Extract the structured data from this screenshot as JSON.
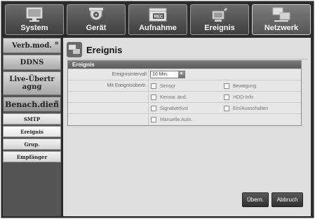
{
  "topnav": {
    "tabs": [
      {
        "label": "System",
        "icon": "monitor-icon",
        "active": false
      },
      {
        "label": "Gerät",
        "icon": "camera-icon",
        "active": false
      },
      {
        "label": "Aufnahme",
        "icon": "rec-icon",
        "active": false
      },
      {
        "label": "Ereignis",
        "icon": "event-icon",
        "active": false
      },
      {
        "label": "Netzwerk",
        "icon": "network-icon",
        "active": true
      }
    ]
  },
  "sidebar": {
    "items": [
      {
        "label": "Verb.mod."
      },
      {
        "label": "DDNS"
      },
      {
        "label": "Live-Übertragng"
      },
      {
        "label": "Benach.dien"
      }
    ],
    "sub_items": [
      {
        "label": "SMTP"
      },
      {
        "label": "Ereignis"
      },
      {
        "label": "Grup."
      },
      {
        "label": "Empfänger"
      }
    ]
  },
  "content": {
    "title": "Ereignis",
    "panel_title": "Ereignis",
    "interval_label": "Ereignisintervall",
    "interval_value": "10 Min.",
    "transfer_label": "Mit Ereignisübertr.",
    "options": [
      {
        "label": "Sensor",
        "checked": false
      },
      {
        "label": "Bewegung",
        "checked": false
      },
      {
        "label": "Kennw. änd.",
        "checked": false
      },
      {
        "label": "HDD-Info",
        "checked": false
      },
      {
        "label": "Signalverlust",
        "checked": false
      },
      {
        "label": "Ein/Ausschalten",
        "checked": false
      },
      {
        "label": "Manuelle Autn.",
        "checked": false
      }
    ]
  },
  "buttons": {
    "apply": "Übern.",
    "cancel": "Abbruch"
  }
}
